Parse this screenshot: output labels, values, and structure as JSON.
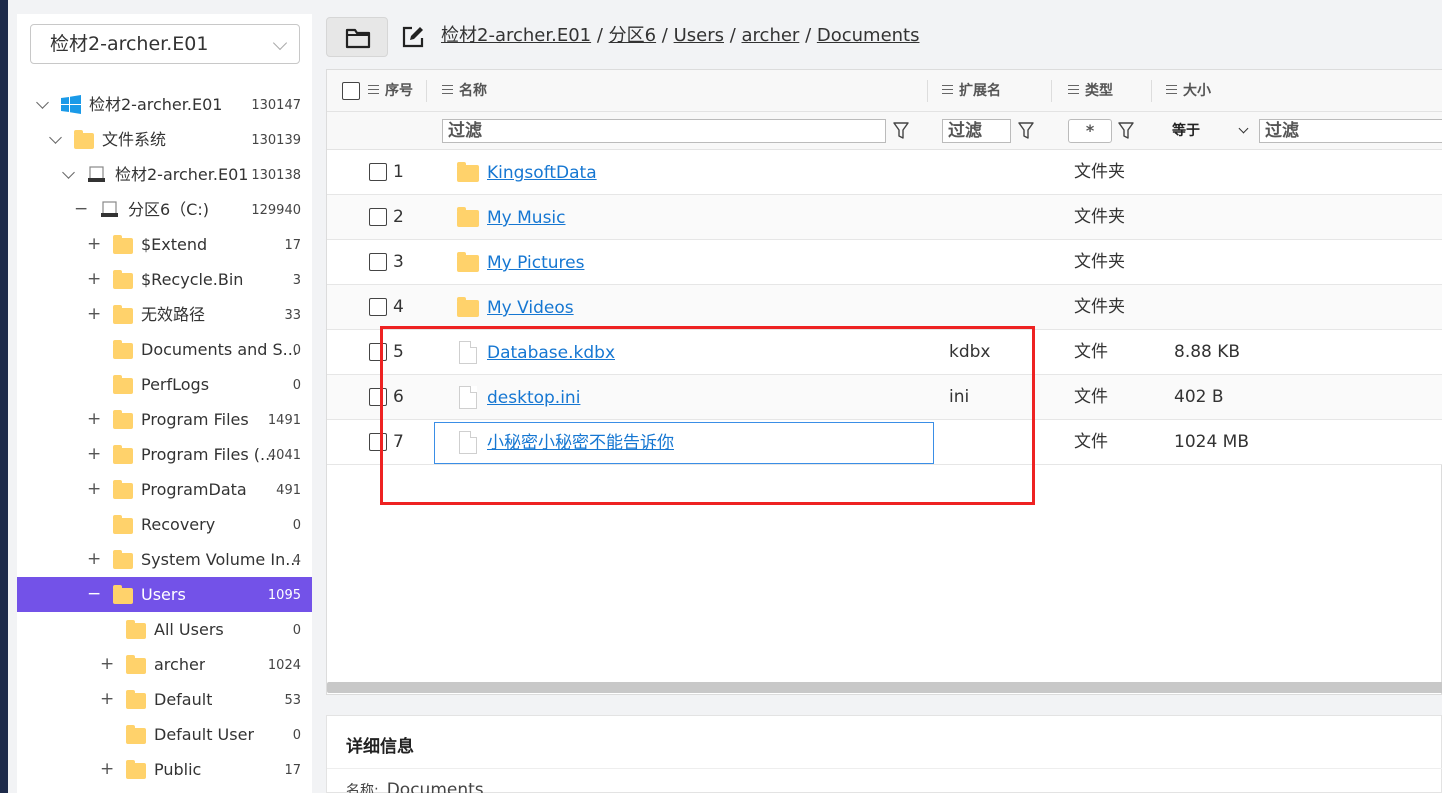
{
  "sidebar": {
    "root_select": "检材2-archer.E01",
    "tree": [
      {
        "label": "检材2-archer.E01",
        "count": "130147",
        "toggle": "chevron",
        "icon": "windows-icon"
      },
      {
        "label": "文件系统",
        "count": "130139",
        "toggle": "chevron",
        "icon": "folder-icon"
      },
      {
        "label": "检材2-archer.E01",
        "count": "130138",
        "toggle": "chevron",
        "icon": "disk-icon"
      },
      {
        "label": "分区6（C:)",
        "count": "129940",
        "toggle": "−",
        "icon": "disk-icon"
      },
      {
        "label": "$Extend",
        "count": "17",
        "toggle": "+",
        "icon": "folder-icon"
      },
      {
        "label": "$Recycle.Bin",
        "count": "3",
        "toggle": "+",
        "icon": "folder-icon"
      },
      {
        "label": "无效路径",
        "count": "33",
        "toggle": "+",
        "icon": "folder-icon"
      },
      {
        "label": "Documents and S...",
        "count": "0",
        "toggle": "",
        "icon": "folder-icon"
      },
      {
        "label": "PerfLogs",
        "count": "0",
        "toggle": "",
        "icon": "folder-icon"
      },
      {
        "label": "Program Files",
        "count": "1491",
        "toggle": "+",
        "icon": "folder-icon"
      },
      {
        "label": "Program Files (...",
        "count": "4041",
        "toggle": "+",
        "icon": "folder-icon"
      },
      {
        "label": "ProgramData",
        "count": "491",
        "toggle": "+",
        "icon": "folder-icon"
      },
      {
        "label": "Recovery",
        "count": "0",
        "toggle": "",
        "icon": "folder-icon"
      },
      {
        "label": "System Volume In...",
        "count": "4",
        "toggle": "+",
        "icon": "folder-icon"
      },
      {
        "label": "Users",
        "count": "1095",
        "toggle": "−",
        "icon": "folder-icon",
        "selected": true
      },
      {
        "label": "All Users",
        "count": "0",
        "toggle": "",
        "icon": "folder-icon"
      },
      {
        "label": "archer",
        "count": "1024",
        "toggle": "+",
        "icon": "folder-icon"
      },
      {
        "label": "Default",
        "count": "53",
        "toggle": "+",
        "icon": "folder-icon"
      },
      {
        "label": "Default User",
        "count": "0",
        "toggle": "",
        "icon": "folder-icon"
      },
      {
        "label": "Public",
        "count": "17",
        "toggle": "+",
        "icon": "folder-icon"
      }
    ]
  },
  "breadcrumb": [
    "检材2-archer.E01",
    "分区6",
    "Users",
    "archer",
    "Documents"
  ],
  "grid": {
    "columns": {
      "index": "序号",
      "name": "名称",
      "ext": "扩展名",
      "type": "类型",
      "size": "大小"
    },
    "filters": {
      "name_placeholder": "过滤",
      "ext_placeholder": "过滤",
      "type_value": "*",
      "size_op": "等于",
      "size_placeholder": "过滤"
    },
    "rows": [
      {
        "index": "1",
        "name": "KingsoftData",
        "ext": "",
        "type": "文件夹",
        "size": "",
        "icon": "folder-icon"
      },
      {
        "index": "2",
        "name": "My Music",
        "ext": "",
        "type": "文件夹",
        "size": "",
        "icon": "folder-icon"
      },
      {
        "index": "3",
        "name": "My Pictures",
        "ext": "",
        "type": "文件夹",
        "size": "",
        "icon": "folder-icon"
      },
      {
        "index": "4",
        "name": "My Videos",
        "ext": "",
        "type": "文件夹",
        "size": "",
        "icon": "folder-icon"
      },
      {
        "index": "5",
        "name": "Database.kdbx",
        "ext": "kdbx",
        "type": "文件",
        "size": "8.88 KB",
        "icon": "file-icon"
      },
      {
        "index": "6",
        "name": "desktop.ini",
        "ext": "ini",
        "type": "文件",
        "size": "402 B",
        "icon": "file-icon"
      },
      {
        "index": "7",
        "name": "小秘密小秘密不能告诉你",
        "ext": "",
        "type": "文件",
        "size": "1024 MB",
        "icon": "file-icon",
        "focused": true
      }
    ]
  },
  "details": {
    "title": "详细信息",
    "name_label": "名称:",
    "name_value": "Documents"
  },
  "colors": {
    "selected": "#7352e8",
    "link": "#1677d2",
    "highlight_box": "#ee2222"
  }
}
